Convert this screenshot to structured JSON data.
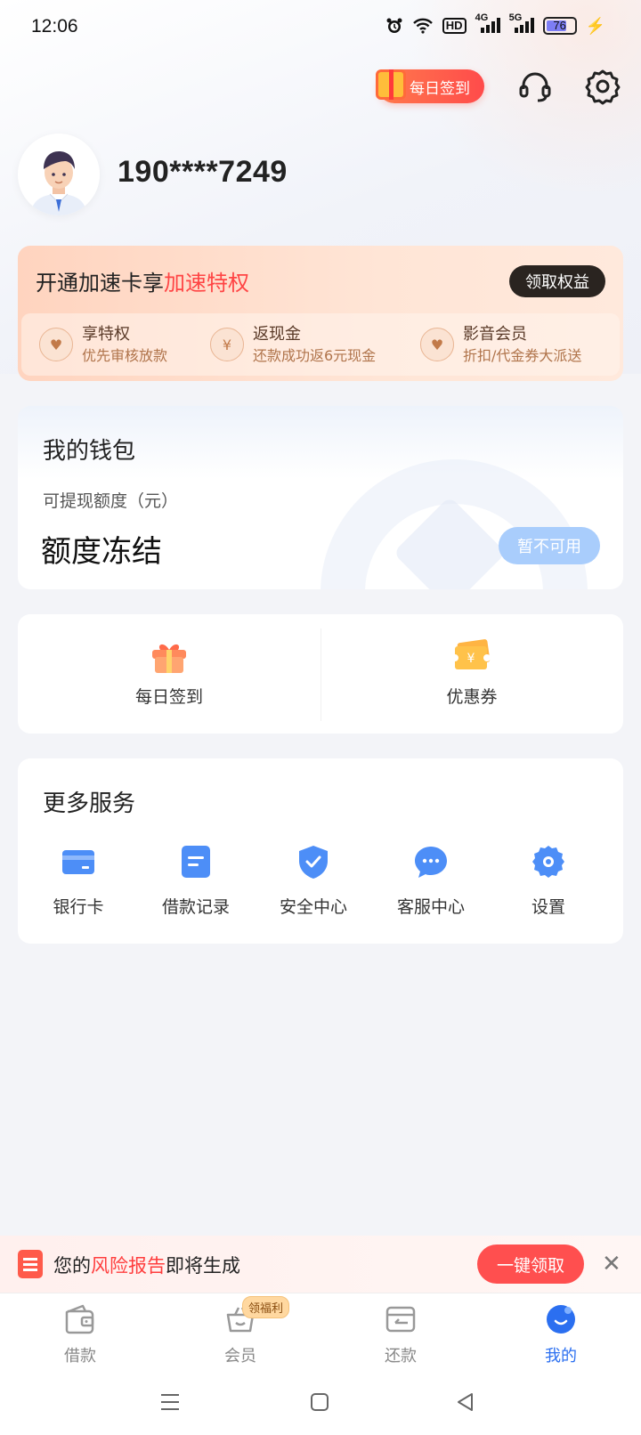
{
  "status_bar": {
    "time": "12:06",
    "network": "HD",
    "signal_4g": "4G",
    "signal_5g": "5G",
    "battery": "76"
  },
  "header": {
    "signin_label": "每日签到",
    "support_icon": "headset-icon",
    "settings_icon": "gear-icon"
  },
  "profile": {
    "phone": "190****7249"
  },
  "accel_card": {
    "title_prefix": "开通加速卡享",
    "title_highlight": "加速特权",
    "button": "领取权益",
    "perks": [
      {
        "title": "享特权",
        "subtitle": "优先审核放款"
      },
      {
        "title": "返现金",
        "subtitle": "还款成功返6元现金"
      },
      {
        "title": "影音会员",
        "subtitle": "折扣/代金券大派送"
      }
    ]
  },
  "wallet": {
    "title": "我的钱包",
    "label": "可提现额度（元）",
    "status": "额度冻结",
    "button": "暂不可用"
  },
  "quick": {
    "items": [
      {
        "label": "每日签到",
        "icon": "gift-icon"
      },
      {
        "label": "优惠券",
        "icon": "coupon-icon"
      }
    ]
  },
  "services": {
    "title": "更多服务",
    "items": [
      {
        "label": "银行卡",
        "icon": "bank-card-icon"
      },
      {
        "label": "借款记录",
        "icon": "record-icon"
      },
      {
        "label": "安全中心",
        "icon": "shield-icon"
      },
      {
        "label": "客服中心",
        "icon": "chat-icon"
      },
      {
        "label": "设置",
        "icon": "gear-icon"
      }
    ]
  },
  "risk_banner": {
    "prefix": "您的",
    "highlight": "风险报告",
    "suffix": "即将生成",
    "button": "一键领取"
  },
  "tabbar": {
    "badge": "领福利",
    "tabs": [
      {
        "label": "借款",
        "icon": "wallet-icon"
      },
      {
        "label": "会员",
        "icon": "basket-icon"
      },
      {
        "label": "还款",
        "icon": "repay-icon"
      },
      {
        "label": "我的",
        "icon": "profile-icon"
      }
    ]
  },
  "colors": {
    "accent_blue": "#2b6ff0",
    "accent_red": "#ff4444",
    "accel_bg": "#ffd4bf"
  }
}
